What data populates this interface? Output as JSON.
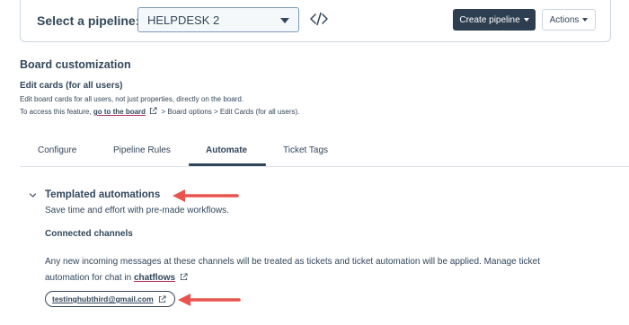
{
  "pipeline": {
    "label": "Select a pipeline:",
    "selected": "HELPDESK 2",
    "create_label": "Create pipeline",
    "actions_label": "Actions"
  },
  "board": {
    "title": "Board customization",
    "edit_title": "Edit cards (for all users)",
    "edit_desc": "Edit board cards for all users, not just properties, directly on the board.",
    "access_prefix": "To access this feature,",
    "access_link": "go to the board",
    "access_suffix": "> Board options > Edit Cards (for all users)."
  },
  "tabs": {
    "configure": "Configure",
    "pipeline_rules": "Pipeline Rules",
    "automate": "Automate",
    "ticket_tags": "Ticket Tags"
  },
  "automation": {
    "title": "Templated automations",
    "subtitle": "Save time and effort with pre-made workflows.",
    "connected_title": "Connected channels",
    "info_line1": "Any new incoming messages at these channels will be treated as tickets and ticket automation will be applied. Manage ticket",
    "info_prefix2": "automation for chat in",
    "chatflows_link": "chatflows",
    "email": "testinghubthird@gmail.com"
  },
  "colors": {
    "text": "#33475b",
    "dark_button": "#2d3e50",
    "annotation_arrow": "#e8534f",
    "link_underline": "#b73060"
  }
}
